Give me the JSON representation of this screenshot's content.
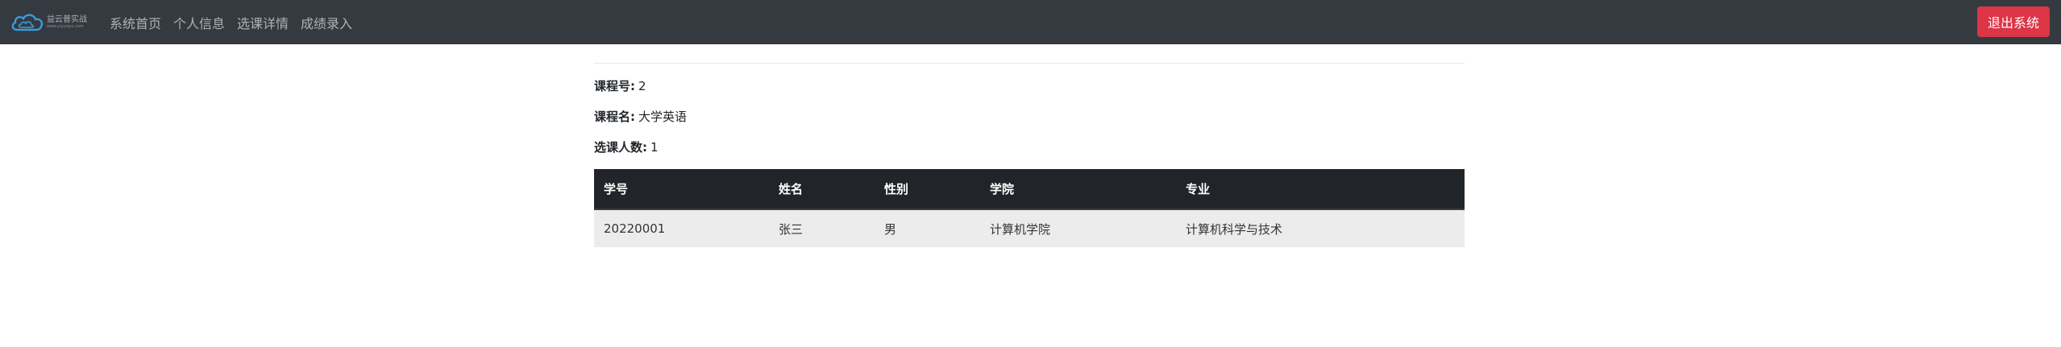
{
  "brand": {
    "logo_text": "益云普实战",
    "logo_subtext": "www.yiyunpu.com"
  },
  "nav": {
    "items": [
      {
        "label": "系统首页"
      },
      {
        "label": "个人信息"
      },
      {
        "label": "选课详情"
      },
      {
        "label": "成绩录入"
      }
    ],
    "logout_label": "退出系统"
  },
  "course": {
    "id_label": "课程号:",
    "id_value": "2",
    "name_label": "课程名:",
    "name_value": "大学英语",
    "count_label": "选课人数:",
    "count_value": "1"
  },
  "table": {
    "headers": [
      "学号",
      "姓名",
      "性别",
      "学院",
      "专业"
    ],
    "rows": [
      [
        "20220001",
        "张三",
        "男",
        "计算机学院",
        "计算机科学与技术"
      ]
    ]
  },
  "colors": {
    "navbar_bg": "#343a40",
    "logout_button": "#dc3545",
    "table_header_bg": "#212529",
    "table_row_bg": "#ececec"
  }
}
